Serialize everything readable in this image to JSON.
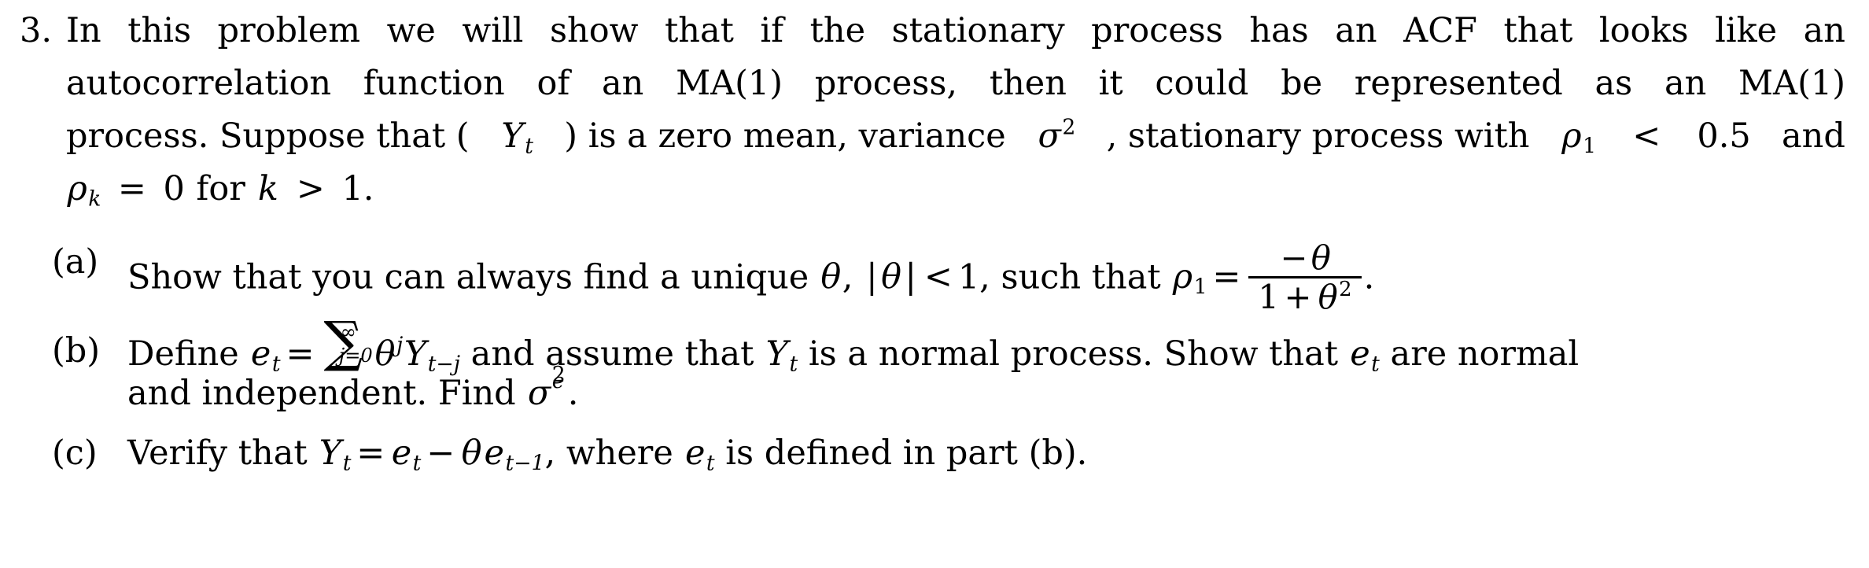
{
  "document": {
    "type": "math-problem-set",
    "font_style": "serif-latex",
    "background_color": "#ffffff",
    "text_color": "#000000"
  },
  "problem": {
    "number": "3.",
    "lines": [
      {
        "id": "line1",
        "words": [
          "In",
          "this",
          "problem",
          "we",
          "will",
          "show",
          "that",
          "if",
          "the",
          "stationary",
          "process",
          "has",
          "an",
          "ACF",
          "that",
          "looks",
          "like",
          "an"
        ]
      },
      {
        "id": "line2",
        "words": [
          "autocorrelation",
          "function",
          "of",
          "an",
          "MA(1)",
          "process,",
          "then",
          "it",
          "could",
          "be",
          "represented",
          "as",
          "an",
          "MA(1)"
        ]
      },
      {
        "id": "line3",
        "segments": {
          "before_Y": "process. Suppose that (",
          "Y": "Y",
          "Y_sub": "t",
          "after_Y": ") is a zero mean, variance ",
          "sigma": "σ",
          "sigma_sup": "2",
          "after_sigma": ", stationary process with ",
          "rho": "ρ",
          "rho_sub": "1",
          "less_than": "<",
          "value": "0.5",
          "tail": "and"
        }
      },
      {
        "id": "line4",
        "segments": {
          "rho": "ρ",
          "rho_sub": "k",
          "equals": "=",
          "zero": "0",
          "for": "for",
          "k": "k",
          "greater_than": ">",
          "one": "1."
        }
      }
    ]
  },
  "subparts": [
    {
      "label": "(a)",
      "id": "part-a",
      "text_before_theta": "Show that you can always find a unique ",
      "theta": "θ",
      "comma": ", ",
      "abs_open": "|",
      "abs_theta": "θ",
      "abs_close": "|",
      "less_than": "<",
      "one": "1",
      "text_middle": ", such that ",
      "rho": "ρ",
      "rho_sub": "1",
      "equals": "=",
      "fraction": {
        "numerator_sign": "−",
        "numerator_theta": "θ",
        "denominator_one": "1",
        "denominator_plus": "+",
        "denominator_theta": "θ",
        "denominator_exp": "2"
      },
      "period": "."
    },
    {
      "label": "(b)",
      "id": "part-b",
      "line1": {
        "define": "Define ",
        "e": "e",
        "e_sub": "t",
        "equals": "=",
        "sum_symbol": "∑",
        "sum_upper": "∞",
        "sum_lower": "j=0",
        "theta": "θ",
        "theta_sup": "j",
        "Y": "Y",
        "Y_sub": "t−j",
        "text_after": " and assume that ",
        "Y2": "Y",
        "Y2_sub": "t",
        "text_tail": " is a normal process.  Show that ",
        "e2": "e",
        "e2_sub": "t",
        "tail2": " are normal"
      },
      "line2": {
        "text": "and independent.  Find ",
        "sigma": "σ",
        "sigma_sub": "e",
        "sigma_sup": "2",
        "period": "."
      }
    },
    {
      "label": "(c)",
      "id": "part-c",
      "verify": "Verify that ",
      "Y": "Y",
      "Y_sub": "t",
      "equals": "=",
      "e": "e",
      "e_sub": "t",
      "minus": "−",
      "theta": "θ",
      "e2": "e",
      "e2_sub": "t−1",
      "comma": ", ",
      "where": "where ",
      "e3": "e",
      "e3_sub": "t",
      "tail": " is defined in part (b)."
    }
  ]
}
